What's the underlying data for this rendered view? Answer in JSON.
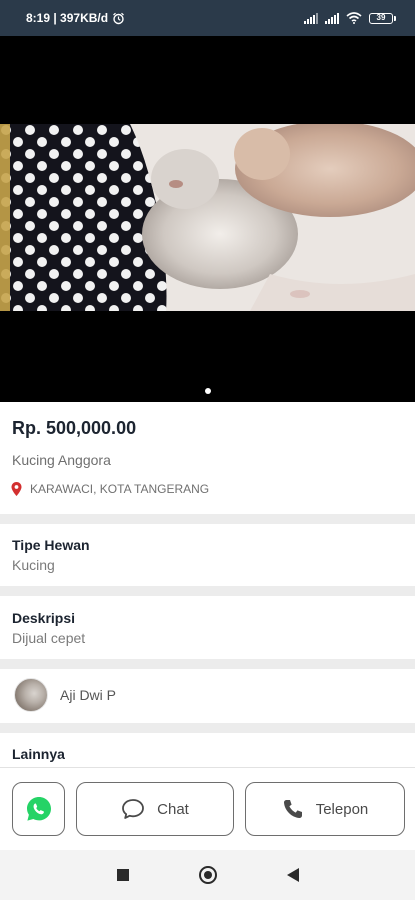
{
  "status_bar": {
    "time_speed": "8:19 | 397KB/d",
    "battery": "39",
    "icons": [
      "alarm-icon",
      "signal-icon",
      "signal-icon",
      "wifi-icon",
      "battery-icon"
    ]
  },
  "media": {
    "image_count": 1,
    "active_index": 0
  },
  "listing": {
    "price": "Rp. 500,000.00",
    "title": "Kucing Anggora",
    "location": "KARAWACI, KOTA TANGERANG"
  },
  "details": {
    "type_heading": "Tipe Hewan",
    "type_value": "Kucing",
    "desc_heading": "Deskripsi",
    "desc_value": "Dijual cepet"
  },
  "seller": {
    "name": "Aji Dwi P"
  },
  "others": {
    "heading": "Lainnya"
  },
  "actions": {
    "chat_label": "Chat",
    "phone_label": "Telepon"
  },
  "colors": {
    "status_bar": "#2b3a4a",
    "whatsapp": "#25d366",
    "location_pin": "#d32f2f",
    "heading": "#1c2430"
  }
}
